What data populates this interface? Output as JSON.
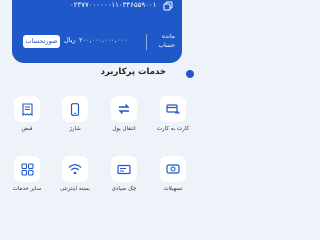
{
  "account_card": {
    "account_number": "۰۲۳۷۷۰۰۰۰۰۰۱۱۰۳۴۶۵۵۹۰۰۱",
    "balance": "۲۰۰,۰۰۰,۰۰۰,۰۰۰",
    "currency": "ریال",
    "balance_label": "مانده حساب",
    "statement_button": "صورتحساب"
  },
  "services": {
    "title": "خدمات پرکاربرد",
    "items": [
      {
        "label": "کارت به کارت",
        "icon": "card-transfer-icon"
      },
      {
        "label": "انتقال پول",
        "icon": "money-transfer-icon"
      },
      {
        "label": "شارژ",
        "icon": "mobile-charge-icon"
      },
      {
        "label": "قبض",
        "icon": "bill-icon"
      },
      {
        "label": "تسهیلات",
        "icon": "loan-icon"
      },
      {
        "label": "چک صیادی",
        "icon": "cheque-icon"
      },
      {
        "label": "بسته اینترنتی",
        "icon": "wifi-icon"
      },
      {
        "label": "سایر خدمات",
        "icon": "more-services-icon"
      }
    ]
  },
  "colors": {
    "primary": "#1f58c8",
    "background": "#eef2f9",
    "tile": "#ffffff"
  }
}
